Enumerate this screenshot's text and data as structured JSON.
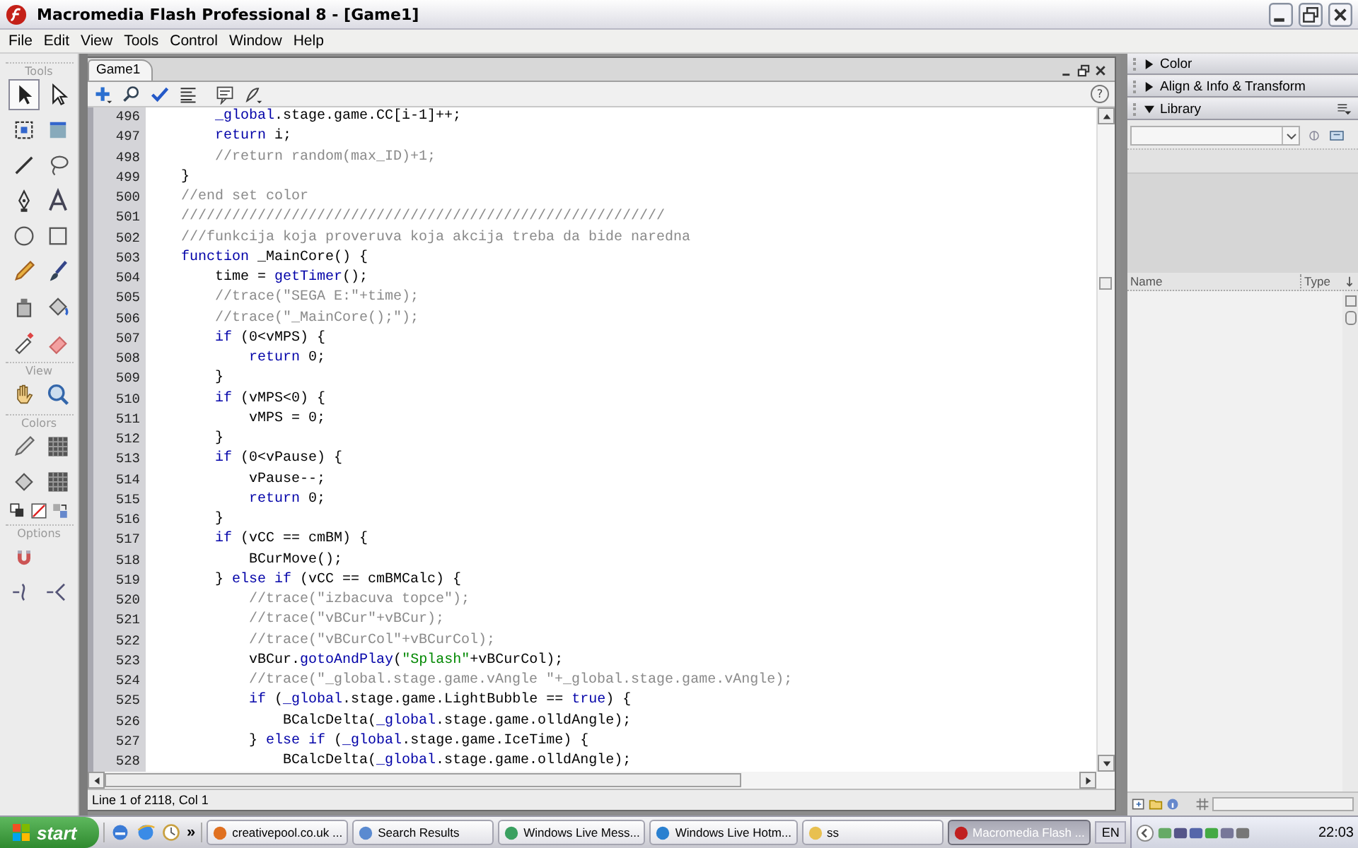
{
  "window": {
    "title": "Macromedia Flash Professional 8 - [Game1]"
  },
  "menu": [
    "File",
    "Edit",
    "View",
    "Tools",
    "Control",
    "Window",
    "Help"
  ],
  "toolbox": {
    "tools_label": "Tools",
    "tools": [
      {
        "selected": true
      },
      {
        "selected": false
      },
      {
        "selected": false
      },
      {
        "selected": false
      },
      {
        "selected": false
      },
      {
        "selected": false
      },
      {
        "selected": false
      },
      {
        "selected": false
      },
      {
        "selected": false
      },
      {
        "selected": false
      },
      {
        "selected": false
      },
      {
        "selected": false
      },
      {
        "selected": false
      },
      {
        "selected": false
      },
      {
        "selected": false
      },
      {
        "selected": false
      }
    ],
    "view_label": "View",
    "colors_label": "Colors",
    "options_label": "Options"
  },
  "document": {
    "tabs": [
      {
        "label": "Game1",
        "selected": true
      }
    ],
    "help": "?",
    "code": [
      {
        "n": "496",
        "t": [
          {
            "kind": "kw",
            "text": "        _global"
          },
          {
            "kind": "p",
            "text": ".stage.game.CC[i-1]++;"
          }
        ]
      },
      {
        "n": "497",
        "t": [
          {
            "kind": "kw",
            "text": "        return"
          },
          {
            "kind": "p",
            "text": " i;"
          }
        ]
      },
      {
        "n": "498",
        "t": [
          {
            "kind": "c",
            "text": "        //return random(max_ID)+1;"
          }
        ]
      },
      {
        "n": "499",
        "t": [
          {
            "kind": "p",
            "text": "    }"
          }
        ]
      },
      {
        "n": "500",
        "t": [
          {
            "kind": "c",
            "text": "    //end set color"
          }
        ]
      },
      {
        "n": "501",
        "t": [
          {
            "kind": "c",
            "text": "    /////////////////////////////////////////////////////////"
          }
        ]
      },
      {
        "n": "502",
        "t": [
          {
            "kind": "c",
            "text": "    ///funkcija koja proveruva koja akcija treba da bide naredna"
          }
        ]
      },
      {
        "n": "503",
        "t": [
          {
            "kind": "kw",
            "text": "    function"
          },
          {
            "kind": "p",
            "text": " _MainCore() {"
          }
        ]
      },
      {
        "n": "504",
        "t": [
          {
            "kind": "p",
            "text": "        time = "
          },
          {
            "kind": "kw",
            "text": "getTimer"
          },
          {
            "kind": "p",
            "text": "();"
          }
        ]
      },
      {
        "n": "505",
        "t": [
          {
            "kind": "c",
            "text": "        //trace(\"SEGA E:\"+time);"
          }
        ]
      },
      {
        "n": "506",
        "t": [
          {
            "kind": "c",
            "text": "        //trace(\"_MainCore();\");"
          }
        ]
      },
      {
        "n": "507",
        "t": [
          {
            "kind": "kw",
            "text": "        if"
          },
          {
            "kind": "p",
            "text": " (0<vMPS) {"
          }
        ]
      },
      {
        "n": "508",
        "t": [
          {
            "kind": "kw",
            "text": "            return"
          },
          {
            "kind": "p",
            "text": " 0;"
          }
        ]
      },
      {
        "n": "509",
        "t": [
          {
            "kind": "p",
            "text": "        }"
          }
        ]
      },
      {
        "n": "510",
        "t": [
          {
            "kind": "kw",
            "text": "        if"
          },
          {
            "kind": "p",
            "text": " (vMPS<0) {"
          }
        ]
      },
      {
        "n": "511",
        "t": [
          {
            "kind": "p",
            "text": "            vMPS = 0;"
          }
        ]
      },
      {
        "n": "512",
        "t": [
          {
            "kind": "p",
            "text": "        }"
          }
        ]
      },
      {
        "n": "513",
        "t": [
          {
            "kind": "kw",
            "text": "        if"
          },
          {
            "kind": "p",
            "text": " (0<vPause) {"
          }
        ]
      },
      {
        "n": "514",
        "t": [
          {
            "kind": "p",
            "text": "            vPause--;"
          }
        ]
      },
      {
        "n": "515",
        "t": [
          {
            "kind": "kw",
            "text": "            return"
          },
          {
            "kind": "p",
            "text": " 0;"
          }
        ]
      },
      {
        "n": "516",
        "t": [
          {
            "kind": "p",
            "text": "        }"
          }
        ]
      },
      {
        "n": "517",
        "t": [
          {
            "kind": "kw",
            "text": "        if"
          },
          {
            "kind": "p",
            "text": " (vCC == cmBM) {"
          }
        ]
      },
      {
        "n": "518",
        "t": [
          {
            "kind": "p",
            "text": "            BCurMove();"
          }
        ]
      },
      {
        "n": "519",
        "t": [
          {
            "kind": "p",
            "text": "        } "
          },
          {
            "kind": "kw",
            "text": "else if"
          },
          {
            "kind": "p",
            "text": " (vCC == cmBMCalc) {"
          }
        ]
      },
      {
        "n": "520",
        "t": [
          {
            "kind": "c",
            "text": "            //trace(\"izbacuva topce\");"
          }
        ]
      },
      {
        "n": "521",
        "t": [
          {
            "kind": "c",
            "text": "            //trace(\"vBCur\"+vBCur);"
          }
        ]
      },
      {
        "n": "522",
        "t": [
          {
            "kind": "c",
            "text": "            //trace(\"vBCurCol\"+vBCurCol);"
          }
        ]
      },
      {
        "n": "523",
        "t": [
          {
            "kind": "p",
            "text": "            vBCur."
          },
          {
            "kind": "kw",
            "text": "gotoAndPlay"
          },
          {
            "kind": "p",
            "text": "("
          },
          {
            "kind": "s",
            "text": "\"Splash\""
          },
          {
            "kind": "p",
            "text": "+vBCurCol);"
          }
        ]
      },
      {
        "n": "524",
        "t": [
          {
            "kind": "c",
            "text": "            //trace(\"_global.stage.game.vAngle \"+_global.stage.game.vAngle);"
          }
        ]
      },
      {
        "n": "525",
        "t": [
          {
            "kind": "kw",
            "text": "            if"
          },
          {
            "kind": "p",
            "text": " ("
          },
          {
            "kind": "kw",
            "text": "_global"
          },
          {
            "kind": "p",
            "text": ".stage.game.LightBubble == "
          },
          {
            "kind": "kw",
            "text": "true"
          },
          {
            "kind": "p",
            "text": ") {"
          }
        ]
      },
      {
        "n": "526",
        "t": [
          {
            "kind": "p",
            "text": "                BCalcDelta("
          },
          {
            "kind": "kw",
            "text": "_global"
          },
          {
            "kind": "p",
            "text": ".stage.game.olldAngle);"
          }
        ]
      },
      {
        "n": "527",
        "t": [
          {
            "kind": "p",
            "text": "            } "
          },
          {
            "kind": "kw",
            "text": "else if"
          },
          {
            "kind": "p",
            "text": " ("
          },
          {
            "kind": "kw",
            "text": "_global"
          },
          {
            "kind": "p",
            "text": ".stage.game.IceTime) {"
          }
        ]
      },
      {
        "n": "528",
        "t": [
          {
            "kind": "p",
            "text": "                BCalcDelta("
          },
          {
            "kind": "kw",
            "text": "_global"
          },
          {
            "kind": "p",
            "text": ".stage.game.olldAngle);"
          }
        ]
      }
    ],
    "status": "Line 1 of 2118, Col 1"
  },
  "panels": [
    {
      "title": "Color",
      "expanded": false
    },
    {
      "title": "Align & Info & Transform",
      "expanded": false
    },
    {
      "title": "Library",
      "expanded": true
    }
  ],
  "library": {
    "columns": [
      "Name",
      "Type"
    ]
  },
  "taskbar": {
    "start": "start",
    "more": "»",
    "tasks": [
      {
        "label": "creativepool.co.uk ...",
        "selected": false
      },
      {
        "label": "Search Results",
        "selected": false
      },
      {
        "label": "Windows Live Mess...",
        "selected": false
      },
      {
        "label": "Windows Live Hotm...",
        "selected": false
      },
      {
        "label": "ss",
        "selected": false
      },
      {
        "label": "Macromedia Flash ...",
        "selected": true
      }
    ],
    "language": "EN",
    "clock": "22:03"
  }
}
